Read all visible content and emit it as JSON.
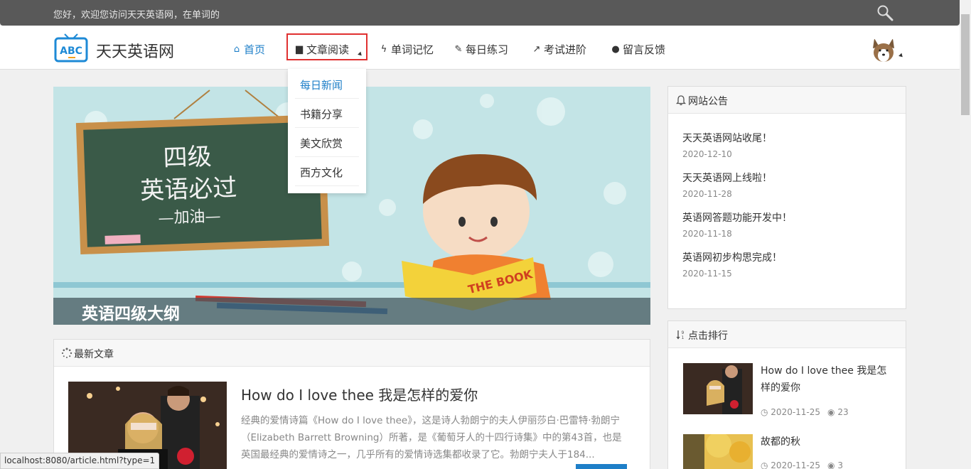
{
  "topbar": {
    "welcome_text": "您好，欢迎您访问天天英语网，在单词的"
  },
  "header": {
    "brand_name": "天天英语网",
    "logo_text": "ABC",
    "nav": [
      {
        "label": "首页",
        "icon": "home-icon"
      },
      {
        "label": "文章阅读",
        "icon": "book-icon"
      },
      {
        "label": "单词记忆",
        "icon": "bolt-icon"
      },
      {
        "label": "每日练习",
        "icon": "edit-icon"
      },
      {
        "label": "考试进阶",
        "icon": "line-chart-icon"
      },
      {
        "label": "留言反馈",
        "icon": "comments-icon"
      }
    ]
  },
  "dropdown": {
    "items": [
      "每日新闻",
      "书籍分享",
      "美文欣赏",
      "西方文化"
    ]
  },
  "banner": {
    "caption": "英语四级大纲",
    "board_line1": "四级",
    "board_line2": "英语必过",
    "board_line3": "—加油—",
    "book_text": "THE BOOK"
  },
  "latest": {
    "title": "最新文章",
    "article": {
      "title": "How do I love thee 我是怎样的爱你",
      "summary": "经典的爱情诗篇《How do I love thee》，这是诗人勃朗宁的夫人伊丽莎白·巴雷特·勃朗宁（Elizabeth Barrett Browning）所著，是《葡萄牙人的十四行诗集》中的第43首，也是英国最经典的爱情诗之一，几乎所有的爱情诗选集都收录了它。勃朗宁夫人于184..."
    }
  },
  "notice": {
    "title": "网站公告",
    "items": [
      {
        "text": "天天英语网站收尾！",
        "date": "2020-12-10"
      },
      {
        "text": "天天英语网上线啦！",
        "date": "2020-11-28"
      },
      {
        "text": "英语网答题功能开发中！",
        "date": "2020-11-18"
      },
      {
        "text": "英语网初步构思完成！",
        "date": "2020-11-15"
      }
    ]
  },
  "rank": {
    "title": "点击排行",
    "items": [
      {
        "title": "How do I love thee 我是怎样的爱你",
        "date": "2020-11-25",
        "views": "23"
      },
      {
        "title": "故都的秋",
        "date": "2020-11-25",
        "views": "3"
      }
    ]
  },
  "status_url": "localhost:8080/article.html?type=1",
  "colors": {
    "accent": "#1e7fc8",
    "topbar": "#595959",
    "highlight_border": "#e03030"
  }
}
